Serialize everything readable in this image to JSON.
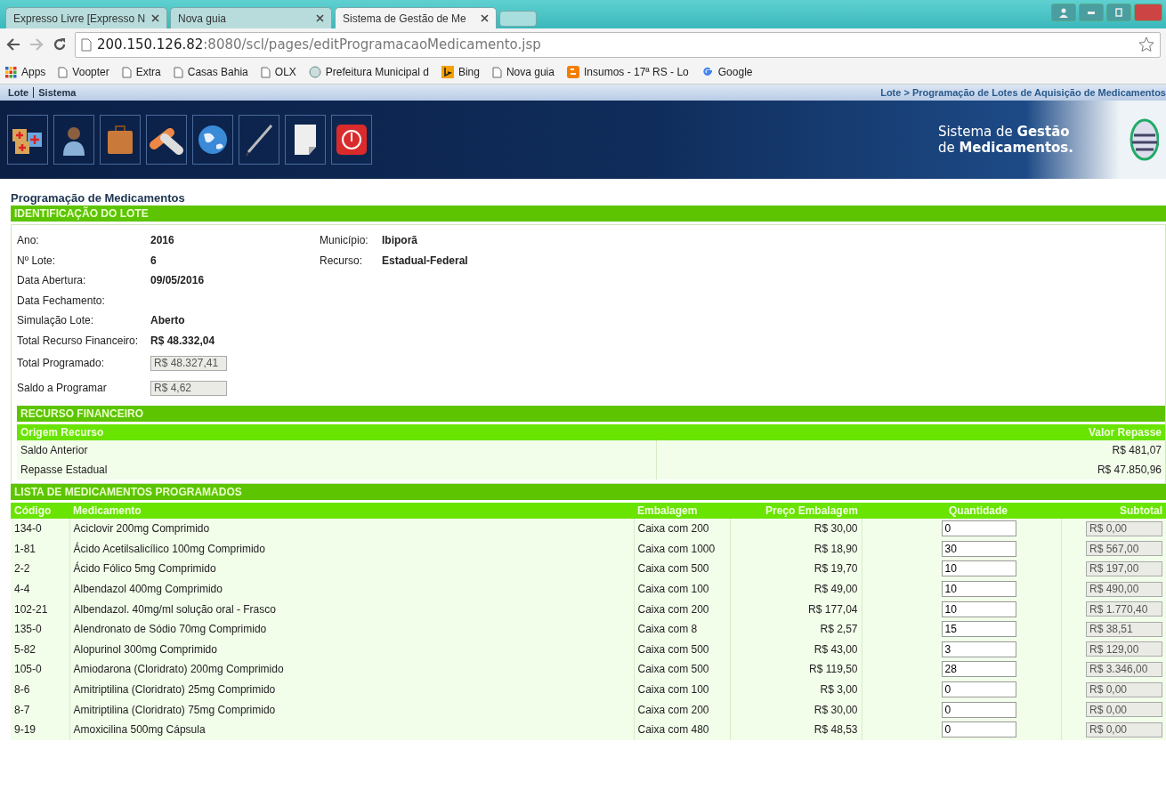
{
  "browser": {
    "tabs": [
      {
        "title": "Expresso Livre [Expresso N",
        "selected": false
      },
      {
        "title": "Nova guia",
        "selected": false
      },
      {
        "title": "Sistema de Gestão de Me",
        "selected": true
      }
    ],
    "url_host": "200.150.126.82",
    "url_rest": ":8080/scl/pages/editProgramacaoMedicamento.jsp",
    "bookmarks": [
      {
        "label": "Apps",
        "kind": "apps"
      },
      {
        "label": "Voopter",
        "kind": "page"
      },
      {
        "label": "Extra",
        "kind": "page"
      },
      {
        "label": "Casas Bahia",
        "kind": "page"
      },
      {
        "label": "OLX",
        "kind": "page"
      },
      {
        "label": "Prefeitura Municipal d",
        "kind": "seal"
      },
      {
        "label": "Bing",
        "kind": "bing"
      },
      {
        "label": "Nova guia",
        "kind": "page"
      },
      {
        "label": "Insumos - 17ª RS - Lo",
        "kind": "blogger"
      },
      {
        "label": "Google",
        "kind": "google"
      }
    ]
  },
  "menu": [
    "Lote",
    "Sistema"
  ],
  "breadcrumb": "Lote > Programação de Lotes de Aquisição de Medicamentos",
  "brand": {
    "line1_a": "Sistema de ",
    "line1_b": "Gestão",
    "line2_a": "de ",
    "line2_b": "Medicamentos."
  },
  "page_title": "Programação de Medicamentos",
  "identification": {
    "title": "IDENTIFICAÇÃO DO LOTE",
    "left": [
      {
        "label": "Ano:",
        "value": "2016",
        "kind": "text"
      },
      {
        "label": "Nº Lote:",
        "value": "6",
        "kind": "text"
      },
      {
        "label": "Data Abertura:",
        "value": "09/05/2016",
        "kind": "text"
      },
      {
        "label": "Data Fechamento:",
        "kind": "text"
      },
      {
        "label": "Simulação Lote:",
        "value": "Aberto",
        "kind": "text"
      },
      {
        "label": "Total Recurso Financeiro:",
        "value": "R$ 48.332,04",
        "kind": "text"
      },
      {
        "label": "Total Programado:",
        "value": "R$ 48.327,41",
        "kind": "readonly"
      },
      {
        "label": "Saldo a Programar",
        "value": "R$ 4,62",
        "kind": "readonly"
      }
    ],
    "right": [
      {
        "label": "Município:",
        "value": "Ibiporã"
      },
      {
        "label": "Recurso:",
        "value": "Estadual-Federal"
      }
    ]
  },
  "resources": {
    "title": "RECURSO FINANCEIRO",
    "columns": [
      "Origem Recurso",
      "Valor Repasse"
    ],
    "rows": [
      [
        "Saldo Anterior",
        "R$ 481,07"
      ],
      [
        "Repasse Estadual",
        "R$ 47.850,96"
      ]
    ]
  },
  "medicines": {
    "title": "LISTA DE MEDICAMENTOS PROGRAMADOS",
    "columns": [
      "Código",
      "Medicamento",
      "Embalagem",
      "Preço Embalagem",
      "Quantidade",
      "Subtotal"
    ],
    "rows": [
      {
        "code": "134-0",
        "name": "Aciclovir 200mg Comprimido",
        "package": "Caixa com 200",
        "price": "R$ 30,00",
        "quantity": "0",
        "subtotal": "R$ 0,00"
      },
      {
        "code": "1-81",
        "name": "Ácido Acetilsalicílico 100mg Comprimido",
        "package": "Caixa com 1000",
        "price": "R$ 18,90",
        "quantity": "30",
        "subtotal": "R$ 567,00"
      },
      {
        "code": "2-2",
        "name": "Ácido Fólico 5mg Comprimido",
        "package": "Caixa com 500",
        "price": "R$ 19,70",
        "quantity": "10",
        "subtotal": "R$ 197,00"
      },
      {
        "code": "4-4",
        "name": "Albendazol 400mg Comprimido",
        "package": "Caixa com 100",
        "price": "R$ 49,00",
        "quantity": "10",
        "subtotal": "R$ 490,00"
      },
      {
        "code": "102-21",
        "name": "Albendazol. 40mg/ml solução oral - Frasco",
        "package": "Caixa com 200",
        "price": "R$ 177,04",
        "quantity": "10",
        "subtotal": "R$ 1.770,40"
      },
      {
        "code": "135-0",
        "name": "Alendronato de Sódio 70mg Comprimido",
        "package": "Caixa com 8",
        "price": "R$ 2,57",
        "quantity": "15",
        "subtotal": "R$ 38,51"
      },
      {
        "code": "5-82",
        "name": "Alopurinol 300mg Comprimido",
        "package": "Caixa com 500",
        "price": "R$ 43,00",
        "quantity": "3",
        "subtotal": "R$ 129,00"
      },
      {
        "code": "105-0",
        "name": "Amiodarona (Cloridrato) 200mg Comprimido",
        "package": "Caixa com 500",
        "price": "R$ 119,50",
        "quantity": "28",
        "subtotal": "R$ 3.346,00"
      },
      {
        "code": "8-6",
        "name": "Amitriptilina (Cloridrato) 25mg Comprimido",
        "package": "Caixa com 100",
        "price": "R$ 3,00",
        "quantity": "0",
        "subtotal": "R$ 0,00"
      },
      {
        "code": "8-7",
        "name": "Amitriptilina (Cloridrato) 75mg Comprimido",
        "package": "Caixa com 200",
        "price": "R$ 30,00",
        "quantity": "0",
        "subtotal": "R$ 0,00"
      },
      {
        "code": "9-19",
        "name": "Amoxicilina 500mg Cápsula",
        "package": "Caixa com 480",
        "price": "R$ 48,53",
        "quantity": "0",
        "subtotal": "R$ 0,00"
      }
    ]
  }
}
